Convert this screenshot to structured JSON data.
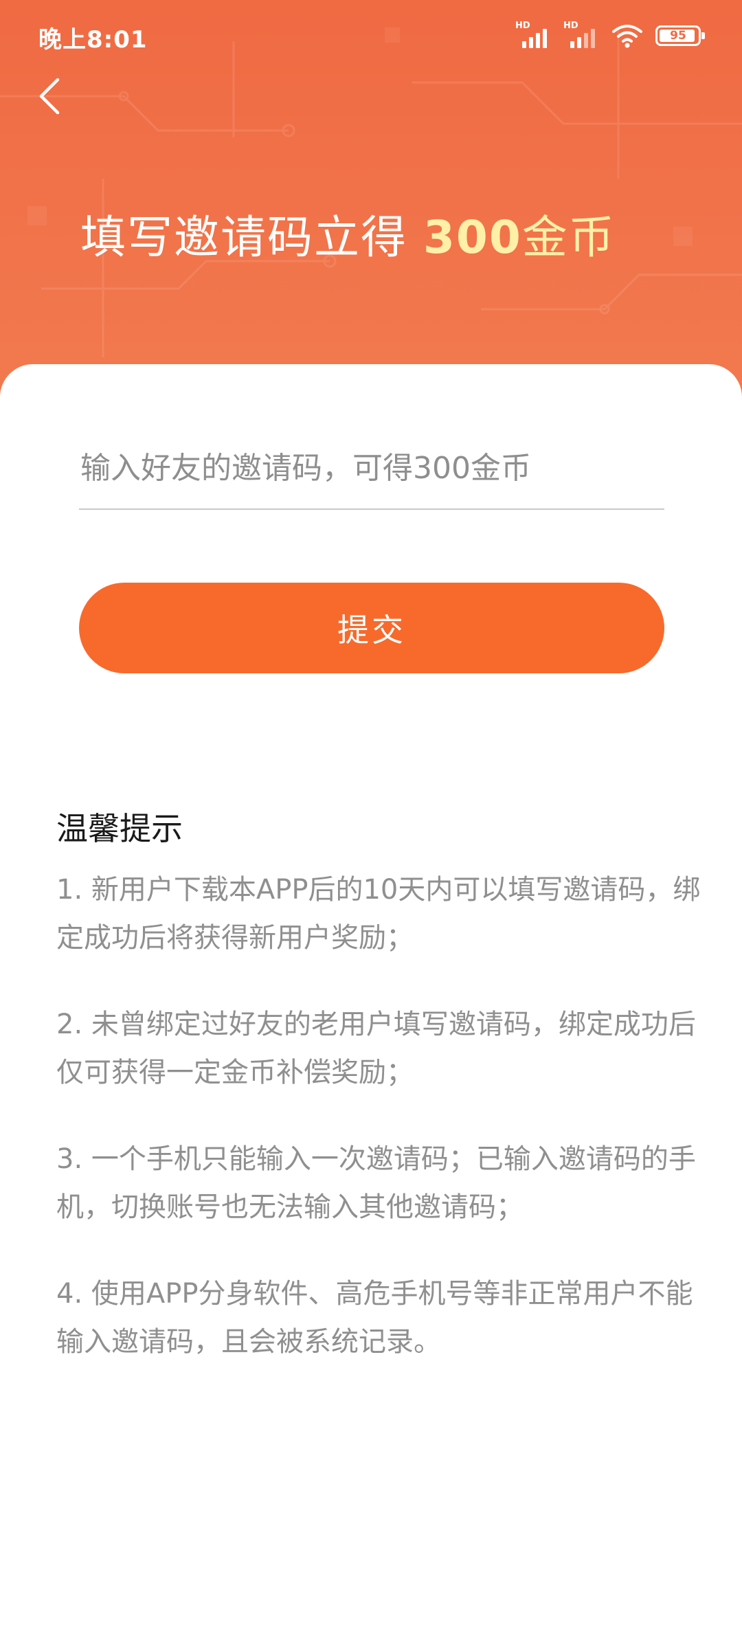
{
  "status_bar": {
    "time": "晚上8:01",
    "signal1_label": "HD",
    "signal2_label": "HD",
    "battery_level": "95",
    "battery_fraction": 0.95,
    "icons": [
      "hd-signal-icon",
      "hd-signal-icon",
      "wifi-icon",
      "battery-icon"
    ]
  },
  "nav": {
    "back_icon": "chevron-left-icon"
  },
  "hero": {
    "title_prefix": "填写邀请码立得 ",
    "title_amount": "300",
    "title_unit": "金币",
    "colors": {
      "background": "#f06a42",
      "amount": "#fff0a8"
    }
  },
  "form": {
    "input_placeholder": "输入好友的邀请码，可得300金币",
    "input_value": "",
    "submit_label": "提交",
    "submit_color": "#f76a2c"
  },
  "tips": {
    "title": "温馨提示",
    "items": [
      "1. 新用户下载本APP后的10天内可以填写邀请码，绑定成功后将获得新用户奖励；",
      "2. 未曾绑定过好友的老用户填写邀请码，绑定成功后仅可获得一定金币补偿奖励；",
      "3. 一个手机只能输入一次邀请码；已输入邀请码的手机，切换账号也无法输入其他邀请码；",
      "4. 使用APP分身软件、高危手机号等非正常用户不能输入邀请码，且会被系统记录。"
    ]
  }
}
